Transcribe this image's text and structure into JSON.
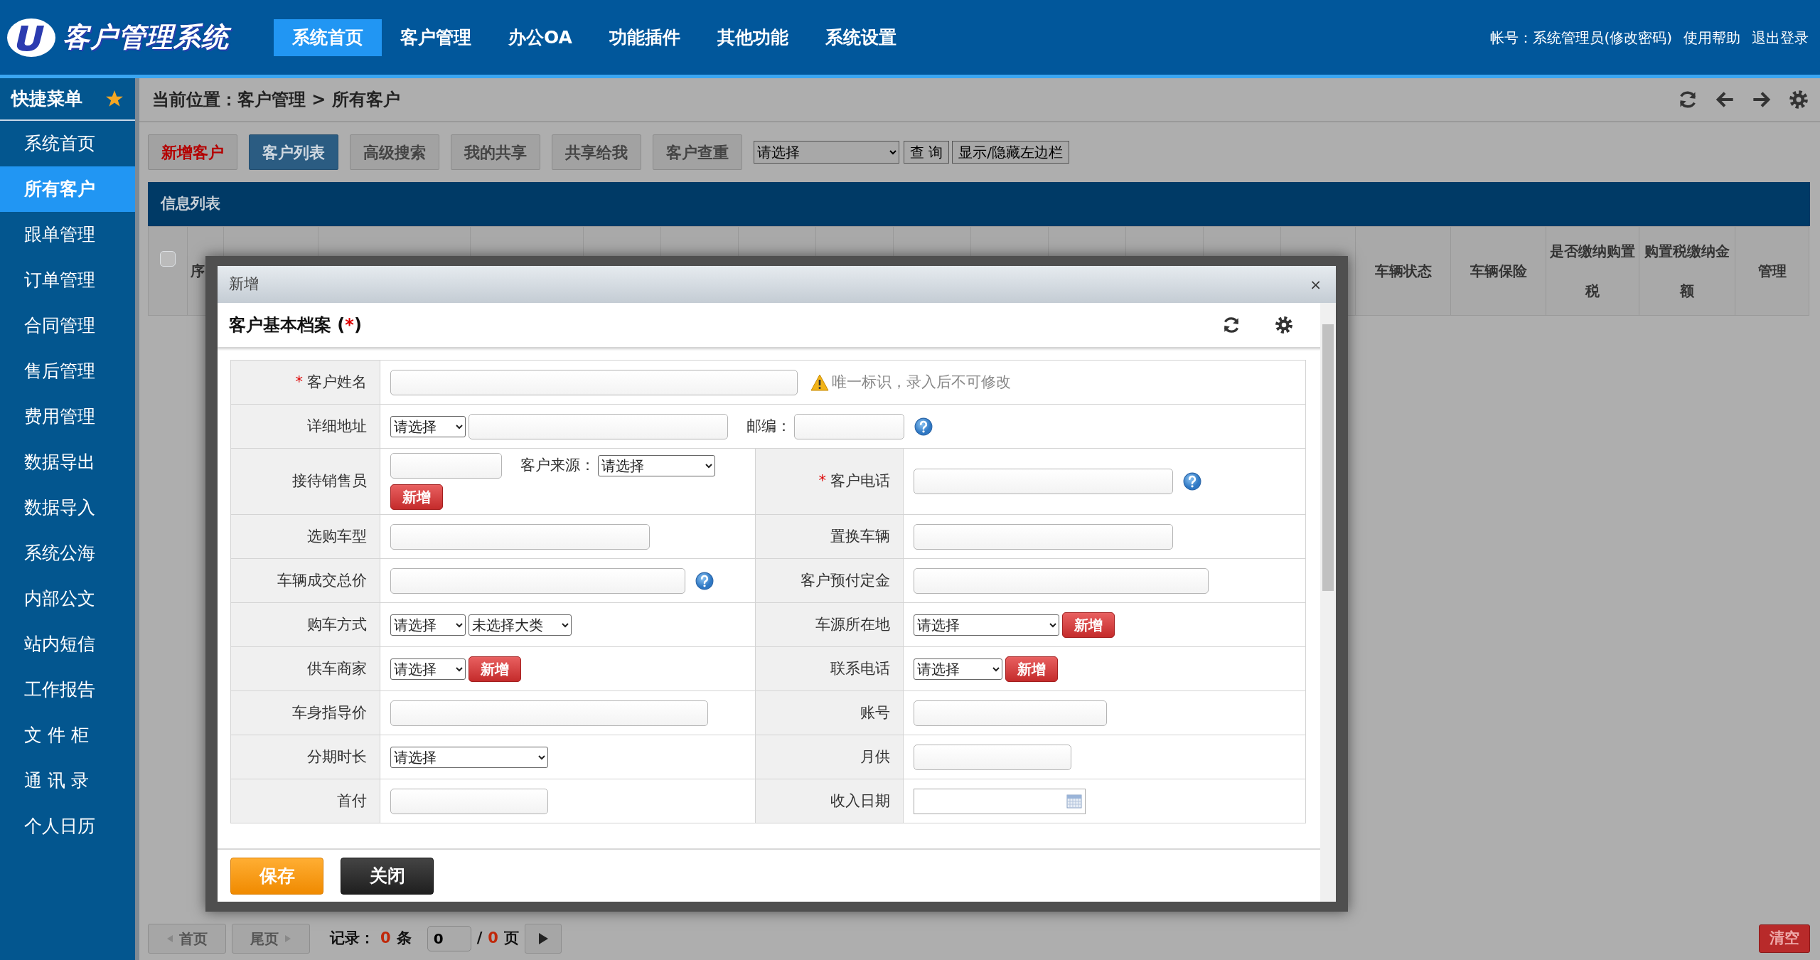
{
  "header": {
    "logo_text": "客户管理系统",
    "nav": [
      {
        "label": "系统首页",
        "selected": true
      },
      {
        "label": "客户管理",
        "selected": false
      },
      {
        "label": "办公OA",
        "selected": false
      },
      {
        "label": "功能插件",
        "selected": false
      },
      {
        "label": "其他功能",
        "selected": false
      },
      {
        "label": "系统设置",
        "selected": false
      }
    ],
    "account": "帐号：系统管理员(修改密码)",
    "links": [
      "使用帮助",
      "退出登录"
    ]
  },
  "sidebar": {
    "title": "快捷菜单",
    "items": [
      {
        "label": "系统首页",
        "selected": false
      },
      {
        "label": "所有客户",
        "selected": true
      },
      {
        "label": "跟单管理",
        "selected": false
      },
      {
        "label": "订单管理",
        "selected": false
      },
      {
        "label": "合同管理",
        "selected": false
      },
      {
        "label": "售后管理",
        "selected": false
      },
      {
        "label": "费用管理",
        "selected": false
      },
      {
        "label": "数据导出",
        "selected": false
      },
      {
        "label": "数据导入",
        "selected": false
      },
      {
        "label": "系统公海",
        "selected": false
      },
      {
        "label": "内部公文",
        "selected": false
      },
      {
        "label": "站内短信",
        "selected": false
      },
      {
        "label": "工作报告",
        "selected": false
      },
      {
        "label": "文 件 柜",
        "selected": false
      },
      {
        "label": "通 讯 录",
        "selected": false
      },
      {
        "label": "个人日历",
        "selected": false
      }
    ]
  },
  "breadcrumb": "当前位置：客户管理 > 所有客户",
  "toolbar": {
    "buttons": [
      {
        "label": "新增客户",
        "kind": "new"
      },
      {
        "label": "客户列表",
        "kind": "active"
      },
      {
        "label": "高级搜索",
        "kind": "normal"
      },
      {
        "label": "我的共享",
        "kind": "normal"
      },
      {
        "label": "共享给我",
        "kind": "normal"
      },
      {
        "label": "客户查重",
        "kind": "normal"
      }
    ],
    "select": "请选择",
    "query": "查 询",
    "toggle": "显示/隐藏左边栏"
  },
  "list": {
    "title": "信息列表",
    "select_all": {
      "checked": false
    },
    "index_column": "序",
    "columns": [
      "车辆状态",
      "车辆保险",
      "是否缴纳购置税",
      "购置税缴纳金额",
      "管理"
    ]
  },
  "modal": {
    "title": "新增",
    "close": "×",
    "section": {
      "title": "客户基本档案 (",
      "mark": "*",
      "title_end": ")"
    },
    "rows": [
      {
        "pairs": [
          {
            "label": "客户姓名",
            "required": true,
            "controls": [
              {
                "kind": "input"
              },
              {
                "kind": "warning",
                "text": "唯一标识，录入后不可修改"
              }
            ]
          }
        ]
      },
      {
        "pairs": [
          {
            "label": "详细地址",
            "required": false,
            "controls": [
              {
                "kind": "select",
                "value": "请选择"
              },
              {
                "kind": "input"
              },
              {
                "kind": "label",
                "text": "邮编："
              },
              {
                "kind": "input"
              },
              {
                "kind": "help"
              }
            ]
          }
        ]
      },
      {
        "pairs": [
          {
            "label": "接待销售员",
            "required": false,
            "controls": [
              {
                "kind": "input"
              },
              {
                "kind": "label",
                "text": "客户来源："
              },
              {
                "kind": "select",
                "value": "请选择"
              },
              {
                "kind": "break"
              },
              {
                "kind": "add",
                "text": "新增"
              }
            ]
          },
          {
            "label": "客户电话",
            "required": true,
            "controls": [
              {
                "kind": "input"
              },
              {
                "kind": "help"
              }
            ]
          }
        ]
      },
      {
        "pairs": [
          {
            "label": "选购车型",
            "required": false,
            "controls": [
              {
                "kind": "input"
              }
            ]
          },
          {
            "label": "置换车辆",
            "required": false,
            "controls": [
              {
                "kind": "input"
              }
            ]
          }
        ]
      },
      {
        "pairs": [
          {
            "label": "车辆成交总价",
            "required": false,
            "controls": [
              {
                "kind": "input"
              },
              {
                "kind": "help"
              }
            ]
          },
          {
            "label": "客户预付定金",
            "required": false,
            "controls": [
              {
                "kind": "input"
              }
            ]
          }
        ]
      },
      {
        "pairs": [
          {
            "label": "购车方式",
            "required": false,
            "controls": [
              {
                "kind": "select",
                "value": "请选择"
              },
              {
                "kind": "select",
                "value": "未选择大类"
              }
            ]
          },
          {
            "label": "车源所在地",
            "required": false,
            "controls": [
              {
                "kind": "select",
                "value": "请选择"
              },
              {
                "kind": "add",
                "text": "新增"
              }
            ]
          }
        ]
      },
      {
        "pairs": [
          {
            "label": "供车商家",
            "required": false,
            "controls": [
              {
                "kind": "select",
                "value": "请选择"
              },
              {
                "kind": "add",
                "text": "新增"
              }
            ]
          },
          {
            "label": "联系电话",
            "required": false,
            "controls": [
              {
                "kind": "select",
                "value": "请选择"
              },
              {
                "kind": "add",
                "text": "新增"
              }
            ]
          }
        ]
      },
      {
        "pairs": [
          {
            "label": "车身指导价",
            "required": false,
            "controls": [
              {
                "kind": "input"
              }
            ]
          },
          {
            "label": "账号",
            "required": false,
            "controls": [
              {
                "kind": "input"
              }
            ]
          }
        ]
      },
      {
        "pairs": [
          {
            "label": "分期时长",
            "required": false,
            "controls": [
              {
                "kind": "select",
                "value": "请选择"
              }
            ]
          },
          {
            "label": "月供",
            "required": false,
            "controls": [
              {
                "kind": "input"
              }
            ]
          }
        ]
      },
      {
        "pairs": [
          {
            "label": "首付",
            "required": false,
            "controls": [
              {
                "kind": "input"
              }
            ]
          },
          {
            "label": "收入日期",
            "required": false,
            "controls": [
              {
                "kind": "date"
              }
            ]
          }
        ]
      }
    ],
    "buttons": [
      {
        "label": "保存",
        "kind": "save"
      },
      {
        "label": "关闭",
        "kind": "close"
      }
    ]
  },
  "pagination": {
    "first": {
      "label": "首页",
      "disabled": true
    },
    "last": {
      "label": "尾页",
      "disabled": true
    },
    "records_label": "记录：",
    "records": "0",
    "records_unit": "条",
    "page": "0",
    "separator": "/",
    "pages": "0",
    "pages_unit": "页"
  },
  "clear_button": "清空"
}
